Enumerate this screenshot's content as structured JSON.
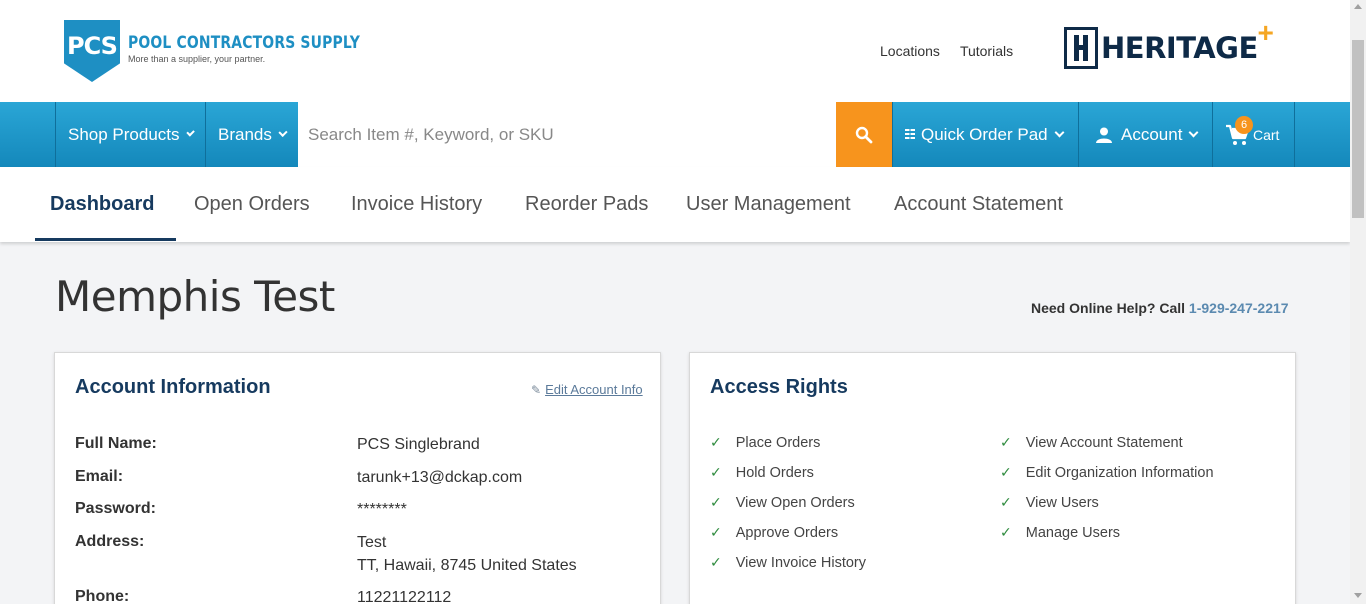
{
  "header": {
    "logo_mark": "PCS",
    "logo_name": "POOL CONTRACTORS SUPPLY",
    "logo_tagline": "More than a supplier, your partner.",
    "links": [
      "Locations",
      "Tutorials"
    ],
    "partner_logo": "HERITAGE",
    "partner_plus": "+"
  },
  "nav": {
    "shop_products": "Shop Products",
    "brands": "Brands",
    "search_placeholder": "Search Item #, Keyword, or SKU",
    "quick_order": "Quick Order Pad",
    "account": "Account",
    "cart": "Cart",
    "cart_count": "6",
    "accent_color": "#f7941d",
    "bar_color": "#1e96c8"
  },
  "tabs": [
    "Dashboard",
    "Open Orders",
    "Invoice History",
    "Reorder Pads",
    "User Management",
    "Account Statement"
  ],
  "page": {
    "title": "Memphis Test",
    "help_prefix": "Need Online Help? Call ",
    "help_phone": "1-929-247-2217"
  },
  "account_info": {
    "title": "Account Information",
    "edit_link": "Edit Account Info",
    "fields": [
      {
        "label": "Full Name:",
        "value": "PCS Singlebrand"
      },
      {
        "label": "Email:",
        "value": "tarunk+13@dckap.com"
      },
      {
        "label": "Password:",
        "value": "********"
      },
      {
        "label": "Address:",
        "value": "Test",
        "value2": "TT, Hawaii, 8745 United States"
      },
      {
        "label": "Phone:",
        "value": "11221122112"
      }
    ]
  },
  "access_rights": {
    "title": "Access Rights",
    "left": [
      "Place Orders",
      "Hold Orders",
      "View Open Orders",
      "Approve Orders",
      "View Invoice History"
    ],
    "right": [
      "View Account Statement",
      "Edit Organization Information",
      "View Users",
      "Manage Users"
    ]
  }
}
